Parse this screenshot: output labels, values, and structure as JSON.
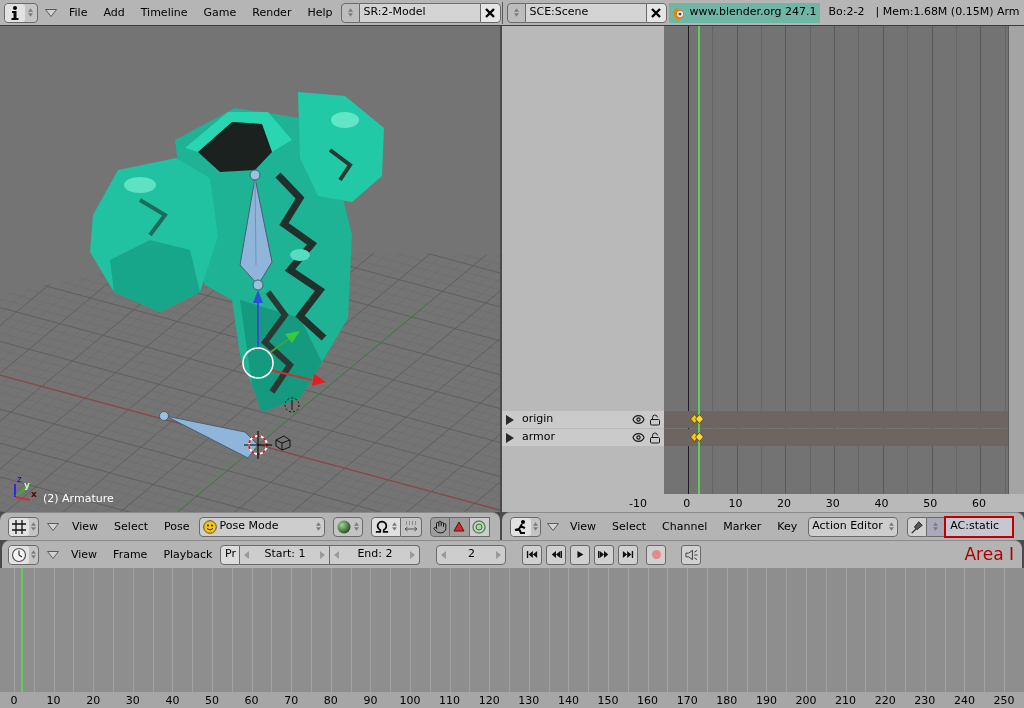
{
  "top_bar": {
    "menus": [
      "File",
      "Add",
      "Timeline",
      "Game",
      "Render",
      "Help"
    ],
    "screen": "SR:2-Model",
    "scene": "SCE:Scene",
    "version": "www.blender.org 247.1",
    "stats": [
      "Bo:2-2",
      "| Mem:1.68M (0.15M) Arm"
    ]
  },
  "viewport": {
    "object_label": "(2) Armature",
    "axis_labels": [
      "z",
      "y",
      "x"
    ],
    "header": {
      "menus": [
        "View",
        "Select",
        "Pose"
      ],
      "mode": "Pose Mode",
      "toggles": [
        {
          "kind": "hand",
          "on": true
        },
        {
          "kind": "triangle",
          "on": true
        },
        {
          "kind": "ring",
          "on": false
        }
      ]
    }
  },
  "action_editor": {
    "channels": [
      {
        "name": "origin",
        "visible": true,
        "locked": false
      },
      {
        "name": "armor",
        "visible": true,
        "locked": false
      }
    ],
    "ruler": [
      "-10",
      "0",
      "10",
      "20",
      "30",
      "40",
      "50",
      "60"
    ],
    "header": {
      "menus": [
        "View",
        "Select",
        "Channel",
        "Marker",
        "Key"
      ],
      "editor": "Action Editor",
      "action": "AC:static",
      "action_highlighted": true
    }
  },
  "timeline": {
    "header": {
      "menus": [
        "View",
        "Frame",
        "Playback"
      ],
      "preview": "Pr",
      "start": "Start: 1",
      "end": "End: 2",
      "frame": "2",
      "record_on": false
    },
    "ruler": [
      "0",
      "10",
      "20",
      "30",
      "40",
      "50",
      "60",
      "70",
      "80",
      "90",
      "100",
      "110",
      "120",
      "130",
      "140",
      "150",
      "160",
      "170",
      "180",
      "190",
      "200",
      "210",
      "220",
      "230",
      "240",
      "250"
    ]
  },
  "annotation": "Area I"
}
